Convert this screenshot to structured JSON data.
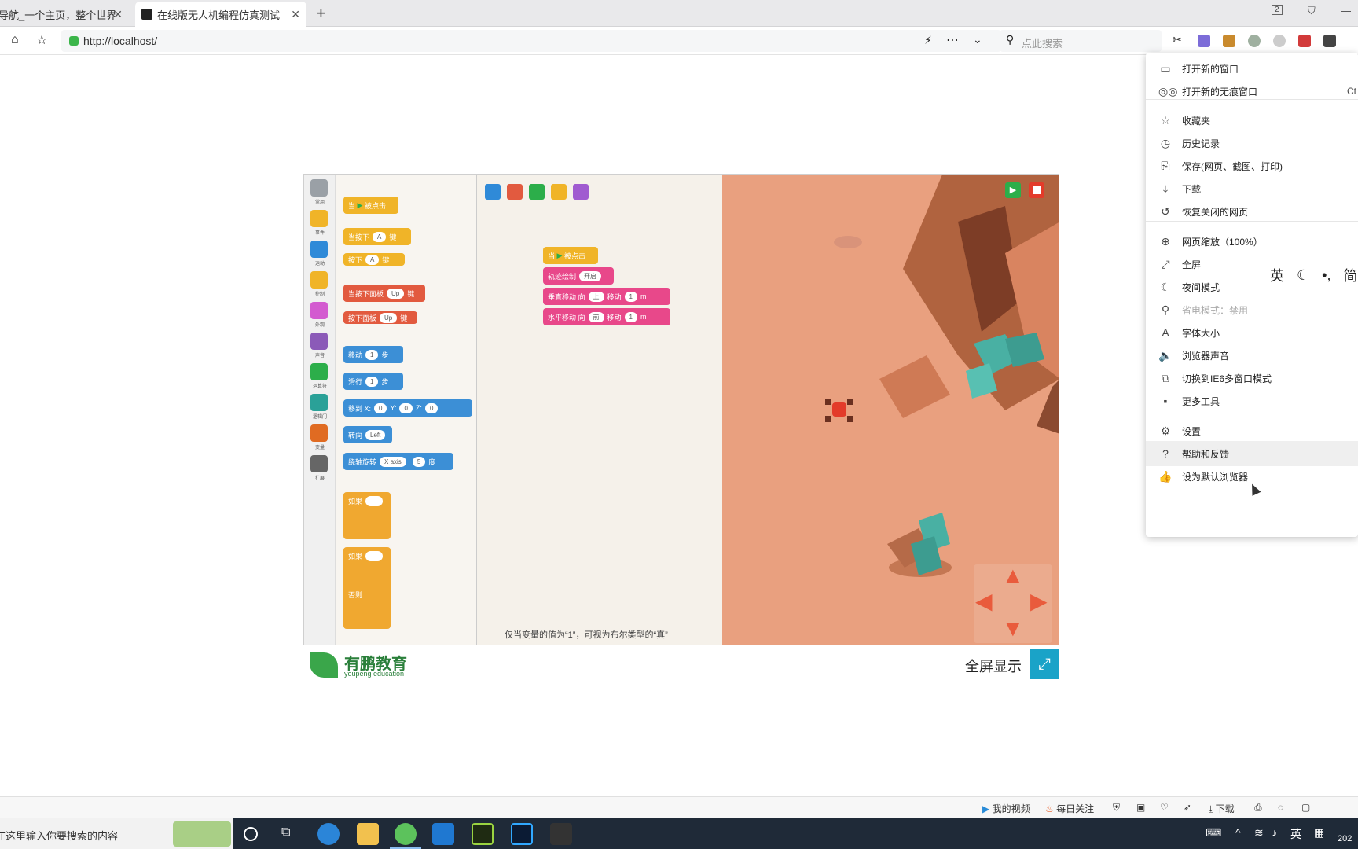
{
  "tabs": [
    {
      "title": "导航_一个主页，整个世界",
      "active": false
    },
    {
      "title": "在线版无人机编程仿真测试",
      "active": true
    }
  ],
  "tab_counter": "2",
  "address": {
    "url": "http://localhost/"
  },
  "search": {
    "placeholder": "点此搜索"
  },
  "page": {
    "categories": [
      "常用",
      "事件",
      "运动",
      "控制",
      "外观",
      "声音",
      "运算符",
      "逻辑门",
      "变量",
      "扩展"
    ],
    "toolbox_blocks": [
      {
        "text": "当",
        "extra": "被点击"
      },
      {
        "text": "当按下",
        "pill": "A",
        "extra": "键"
      },
      {
        "text": "按下",
        "pill": "A",
        "extra": "键"
      },
      {
        "text": "当按下面板",
        "pill": "Up",
        "extra": "键"
      },
      {
        "text": "按下面板",
        "pill": "Up",
        "extra": "键"
      },
      {
        "text": "移动",
        "pill": "1",
        "extra": "步"
      },
      {
        "text": "滑行",
        "pill": "1",
        "extra": "步"
      },
      {
        "text": "移到 X:",
        "pill": "0",
        "extra": "Y:",
        "pill2": "0",
        "extra2": "Z:",
        "pill3": "0"
      },
      {
        "text": "转向",
        "pill": "Left"
      },
      {
        "text": "绕轴旋转",
        "pill": "X axis",
        "pill2": "5",
        "extra2": "度"
      },
      {
        "text": "如果"
      },
      {
        "text": "如果"
      },
      {
        "text": "否则"
      }
    ],
    "workspace_blocks": [
      {
        "text": "当",
        "extra": "被点击"
      },
      {
        "text": "轨迹绘制",
        "pill": "开启"
      },
      {
        "text": "垂直移动 向",
        "pill": "上",
        "extra": "移动",
        "pill2": "1",
        "extra2": "m"
      },
      {
        "text": "水平移动 向",
        "pill": "前",
        "extra": "移动",
        "pill2": "1",
        "extra2": "m"
      }
    ],
    "hint": "仅当变量的值为“1”，可视为布尔类型的“真”",
    "logo_cn": "有鹏教育",
    "logo_en": "youpeng education",
    "fullscreen_label": "全屏显示"
  },
  "menu": {
    "items": [
      {
        "icon": "window-icon",
        "label": "打开新的窗口"
      },
      {
        "icon": "incognito-icon",
        "label": "打开新的无痕窗口",
        "shortcut": "Ct"
      },
      {
        "icon": "star-list-icon",
        "label": "收藏夹"
      },
      {
        "icon": "clock-icon",
        "label": "历史记录"
      },
      {
        "icon": "save-icon",
        "label": "保存(网页、截图、打印)"
      },
      {
        "icon": "download-icon",
        "label": "下载"
      },
      {
        "icon": "restore-icon",
        "label": "恢复关闭的网页"
      },
      {
        "icon": "zoom-icon",
        "label": "网页缩放（100%）"
      },
      {
        "icon": "fullscreen-icon",
        "label": "全屏"
      },
      {
        "icon": "moon-icon",
        "label": "夜间模式"
      },
      {
        "icon": "plug-icon",
        "label": "省电模式：禁用",
        "disabled": true
      },
      {
        "icon": "font-icon",
        "label": "字体大小"
      },
      {
        "icon": "speaker-icon",
        "label": "浏览器声音"
      },
      {
        "icon": "ie-window-icon",
        "label": "切换到IE6多窗口模式"
      },
      {
        "icon": "toolbox-icon",
        "label": "更多工具"
      },
      {
        "icon": "gear-icon",
        "label": "设置"
      },
      {
        "icon": "help-icon",
        "label": "帮助和反馈",
        "highlighted": true
      },
      {
        "icon": "thumb-icon",
        "label": "设为默认浏览器"
      }
    ]
  },
  "ime": {
    "lang": "英",
    "punct": "•,",
    "mode": "简"
  },
  "statusbar": {
    "my_video": "我的视频",
    "daily": "每日关注",
    "download": "下载"
  },
  "taskbar": {
    "search_text": "在这里输入你要搜索的内容",
    "ime_lang": "英",
    "clock": "202"
  }
}
